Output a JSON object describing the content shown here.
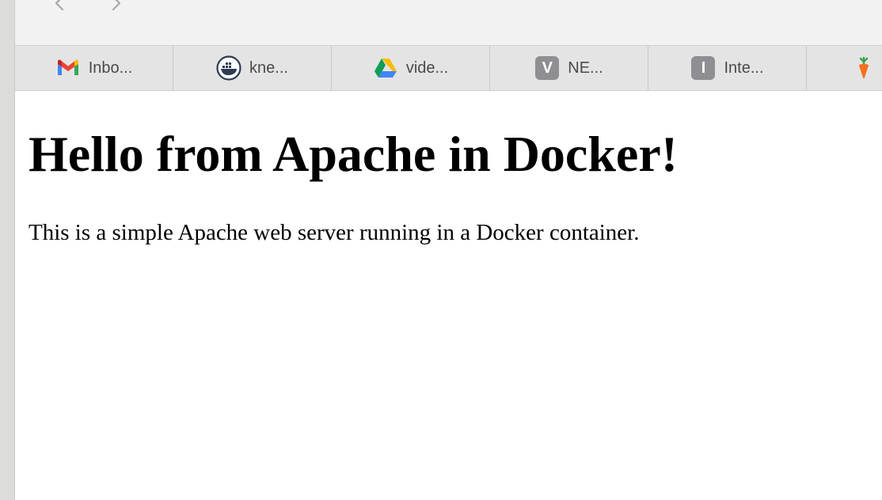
{
  "browser": {
    "nav": {
      "back_icon": "chevron-left-icon",
      "forward_icon": "chevron-right-icon"
    },
    "tabs": [
      {
        "label": "Inbo...",
        "icon": "gmail-icon"
      },
      {
        "label": "kne...",
        "icon": "docker-icon"
      },
      {
        "label": "vide...",
        "icon": "google-drive-icon"
      },
      {
        "label": "NE...",
        "icon": "letter-v-icon",
        "badge": "V"
      },
      {
        "label": "Inte...",
        "icon": "letter-i-icon",
        "badge": "I"
      },
      {
        "label": "",
        "icon": "carrot-icon"
      }
    ]
  },
  "page": {
    "heading": "Hello from Apache in Docker!",
    "paragraph": "This is a simple Apache web server running in a Docker container."
  },
  "colors": {
    "toolbar_bg": "#f2f2f2",
    "tabbar_bg": "#e4e4e4",
    "badge_bg": "#8e8e93"
  }
}
